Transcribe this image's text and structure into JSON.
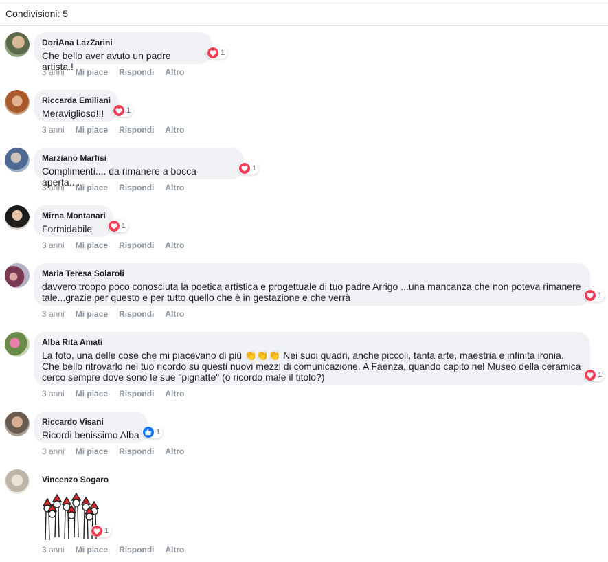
{
  "shares_label": "Condivisioni: 5",
  "actions": {
    "like": "Mi piace",
    "reply": "Rispondi",
    "more": "Altro"
  },
  "comments": [
    {
      "author": "DoriAna LazZarini",
      "text": "Che bello aver avuto un padre artista.!",
      "time": "3 anni",
      "reaction_type": "love",
      "reaction_count": "1"
    },
    {
      "author": "Riccarda Emiliani",
      "text": "Meraviglioso!!!",
      "time": "3 anni",
      "reaction_type": "love",
      "reaction_count": "1"
    },
    {
      "author": "Marziano Marfisi",
      "text": "Complimenti.... da rimanere a bocca aperta....",
      "time": "3 anni",
      "reaction_type": "love",
      "reaction_count": "1"
    },
    {
      "author": "Mirna Montanari",
      "text": "Formidabile",
      "time": "3 anni",
      "reaction_type": "love",
      "reaction_count": "1"
    },
    {
      "author": "Maria Teresa Solaroli",
      "text": "davvero troppo poco conosciuta la poetica artistica e progettuale di tuo padre Arrigo ...una mancanza che non poteva rimanere\ntale...grazie per questo e per tutto quello che è in gestazione e che verrà",
      "time": "3 anni",
      "reaction_type": "love",
      "reaction_count": "1"
    },
    {
      "author": "Alba Rita Amati",
      "text_before_emoji": "La foto, una delle cose che mi piacevano di più ",
      "emoji": "👏👏👏",
      "text_after_emoji": " Nei suoi quadri, anche piccoli, tanta arte, maestria e infinita ironia.\nChe bello ritrovarlo nel tuo ricordo su questi nuovi mezzi di comunicazione. A Faenza, quando capito nel Museo della ceramica\ncerco sempre dove sono le sue \"pignatte\" (o ricordo male il titolo?)",
      "time": "3 anni",
      "reaction_type": "love",
      "reaction_count": "1"
    },
    {
      "author": "Riccardo Visani",
      "text": "Ricordi benissimo Alba",
      "time": "3 anni",
      "reaction_type": "like",
      "reaction_count": "1"
    },
    {
      "author": "Vincenzo Sogaro",
      "sticker": "christmas-figures-sticker",
      "time": "3 anni",
      "reaction_type": "love",
      "reaction_count": "1"
    }
  ],
  "colors": {
    "bubble": "#f0f2f5",
    "love": "#f33e58",
    "like": "#1877f2",
    "meta": "#8d949e"
  }
}
